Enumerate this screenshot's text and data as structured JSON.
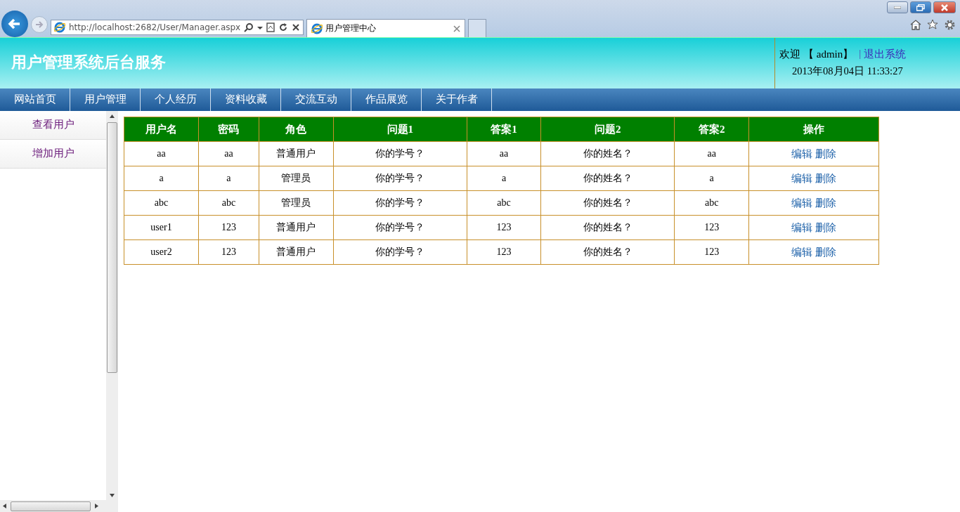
{
  "browser": {
    "address": "http://localhost:2682/User/Manager.aspx",
    "tab": {
      "title": "用户管理中心",
      "selected": true
    }
  },
  "header": {
    "title": "用户管理系统后台服务",
    "welcome": "欢迎",
    "user": "【 admin】",
    "separator": "|",
    "logout": "退出系统",
    "datetime": "2013年08月04日  11:33:27"
  },
  "nav": [
    "网站首页",
    "用户管理",
    "个人经历",
    "资料收藏",
    "交流互动",
    "作品展览",
    "关于作者"
  ],
  "sidebar": {
    "items": [
      "查看用户",
      "增加用户"
    ]
  },
  "table": {
    "columns": [
      "用户名",
      "密码",
      "角色",
      "问题1",
      "答案1",
      "问题2",
      "答案2",
      "操作"
    ],
    "rows": [
      {
        "cells": [
          "aa",
          "aa",
          "普通用户",
          "你的学号？",
          "aa",
          "你的姓名？",
          "aa"
        ],
        "actions": [
          "编辑",
          "删除"
        ]
      },
      {
        "cells": [
          "a",
          "a",
          "管理员",
          "你的学号？",
          "a",
          "你的姓名？",
          "a"
        ],
        "actions": [
          "编辑",
          "删除"
        ]
      },
      {
        "cells": [
          "abc",
          "abc",
          "管理员",
          "你的学号？",
          "abc",
          "你的姓名？",
          "abc"
        ],
        "actions": [
          "编辑",
          "删除"
        ]
      },
      {
        "cells": [
          "user1",
          "123",
          "普通用户",
          "你的学号？",
          "123",
          "你的姓名？",
          "123"
        ],
        "actions": [
          "编辑",
          "删除"
        ]
      },
      {
        "cells": [
          "user2",
          "123",
          "普通用户",
          "你的学号？",
          "123",
          "你的姓名？",
          "123"
        ],
        "actions": [
          "编辑",
          "删除"
        ]
      }
    ]
  }
}
